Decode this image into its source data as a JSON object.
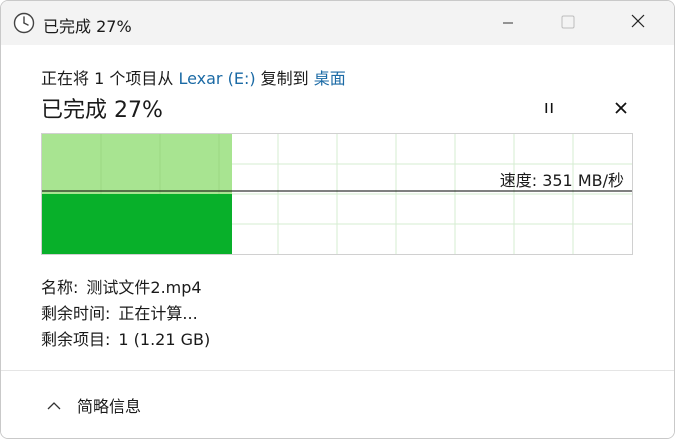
{
  "window": {
    "title": "已完成 27%",
    "icon": "clock-icon"
  },
  "titlebar": {
    "minimize": "minimize-icon",
    "maximize": "maximize-icon",
    "close": "close-icon"
  },
  "copy": {
    "prefix": "正在将 1 个项目从 ",
    "source": "Lexar (E:)",
    "middle": " 复制到 ",
    "destination": "桌面"
  },
  "status": {
    "title": "已完成 27%",
    "progress_percent": 27
  },
  "controls": {
    "pause": "pause-icon",
    "stop": "stop-icon"
  },
  "graph": {
    "speed_label": "速度: 351 MB/秒",
    "colors": {
      "fill_light": "#a8e491",
      "fill_dark": "#08b02a",
      "grid": "#d6ecd2",
      "line": "#000000"
    }
  },
  "details": {
    "name_label": "名称:",
    "name_value": "测试文件2.mp4",
    "time_label": "剩余时间:",
    "time_value": "正在计算...",
    "items_label": "剩余项目:",
    "items_value": "1 (1.21 GB)"
  },
  "footer": {
    "less_info": "简略信息",
    "icon": "chevron-up-icon"
  }
}
